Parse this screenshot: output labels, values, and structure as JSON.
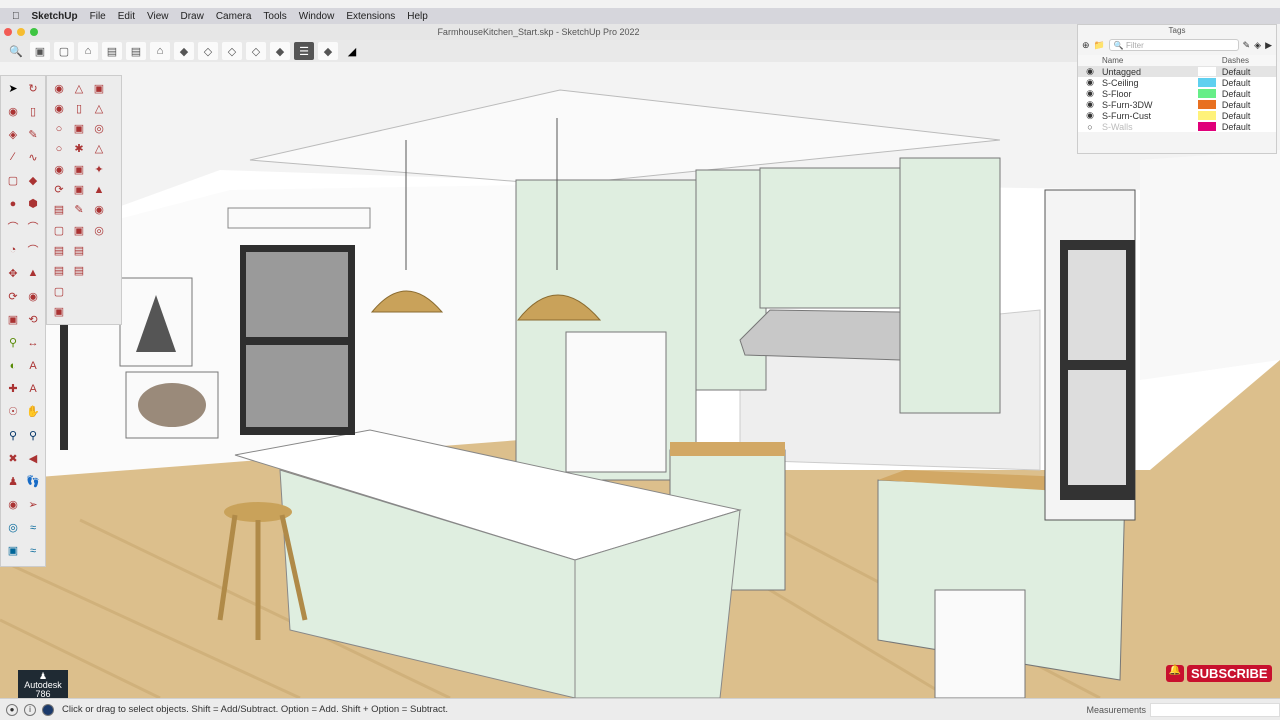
{
  "menubar": {
    "app": "SketchUp",
    "items": [
      "File",
      "Edit",
      "View",
      "Draw",
      "Camera",
      "Tools",
      "Window",
      "Extensions",
      "Help"
    ]
  },
  "window": {
    "title": "FarmhouseKitchen_Start.skp - SketchUp Pro 2022"
  },
  "tags_panel": {
    "title": "Tags",
    "filter_placeholder": "Filter",
    "columns": [
      "Name",
      "Dashes"
    ],
    "rows": [
      {
        "name": "Untagged",
        "color": "#ffffff",
        "dashes": "Default",
        "visible": true
      },
      {
        "name": "S-Ceiling",
        "color": "#5fd0f0",
        "dashes": "Default",
        "visible": true
      },
      {
        "name": "S-Floor",
        "color": "#66ee88",
        "dashes": "Default",
        "visible": true
      },
      {
        "name": "S-Furn-3DW",
        "color": "#e87020",
        "dashes": "Default",
        "visible": true
      },
      {
        "name": "S-Furn-Cust",
        "color": "#fff27a",
        "dashes": "Default",
        "visible": true
      },
      {
        "name": "S-Walls",
        "color": "#e0007a",
        "dashes": "Default",
        "visible": false
      }
    ]
  },
  "status": {
    "hint": "Click or drag to select objects. Shift = Add/Subtract. Option = Add. Shift + Option = Subtract.",
    "measurements_label": "Measurements"
  },
  "overlay": {
    "badge_line1": "Autodesk",
    "badge_line2": "786",
    "subscribe": "SUBSCRIBE"
  }
}
